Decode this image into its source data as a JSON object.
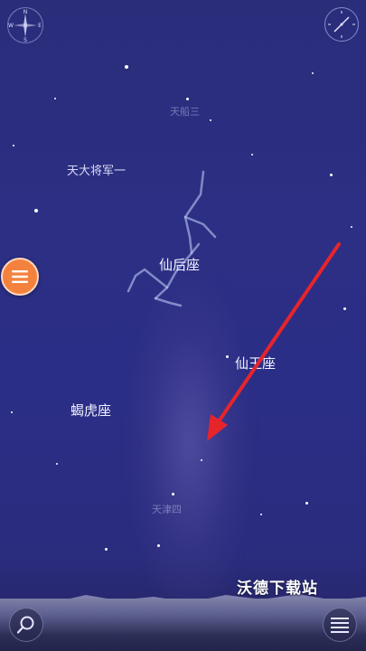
{
  "sky": {
    "constellations": [
      {
        "name": "天船三",
        "style": "dim"
      },
      {
        "name": "天大将军一",
        "style": "normal"
      },
      {
        "name": "仙后座",
        "style": "big"
      },
      {
        "name": "仙王座",
        "style": "big"
      },
      {
        "name": "蝎虎座",
        "style": "big"
      },
      {
        "name": "天津四",
        "style": "dim"
      }
    ]
  },
  "toolbar": {
    "compass_letters": {
      "n": "N",
      "e": "E",
      "s": "S",
      "w": "W"
    },
    "menu_icon": "menu-icon",
    "search_icon": "search-icon",
    "list_icon": "list-icon",
    "clock_icon": "compass-needle-icon"
  },
  "annotation": {
    "arrow_color": "#e8242b"
  },
  "watermark": {
    "text": "沃德下载站"
  },
  "colors": {
    "sky": "#2c2f84",
    "menu_button": "#f4823e"
  }
}
